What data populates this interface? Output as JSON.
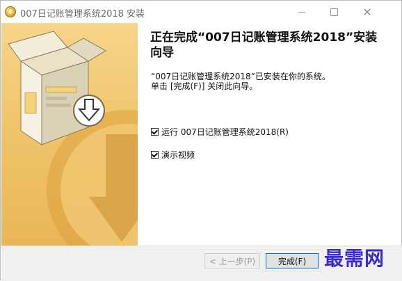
{
  "window": {
    "title": "007日记账管理系统2018 安装",
    "controls": {
      "minimize_icon": "minimize-icon",
      "maximize_icon": "maximize-icon",
      "close_icon": "close-icon"
    }
  },
  "content": {
    "heading": "正在完成“007日记账管理系统2018”安装向导",
    "line1": "“007日记账管理系统2018”已安装在你的系统。",
    "line2": "单击 [完成(F)] 关闭此向导。",
    "options": [
      {
        "label": "运行 007日记账管理系统2018(R)",
        "checked": true
      },
      {
        "label": "演示视频",
        "checked": true
      }
    ]
  },
  "footer": {
    "back_label": "< 上一步(P)",
    "finish_label": "完成(F)"
  },
  "watermark": "最需网",
  "colors": {
    "accent": "#0078d7",
    "sidebar": "#f0c56d",
    "watermark": "#3a2cc8"
  }
}
